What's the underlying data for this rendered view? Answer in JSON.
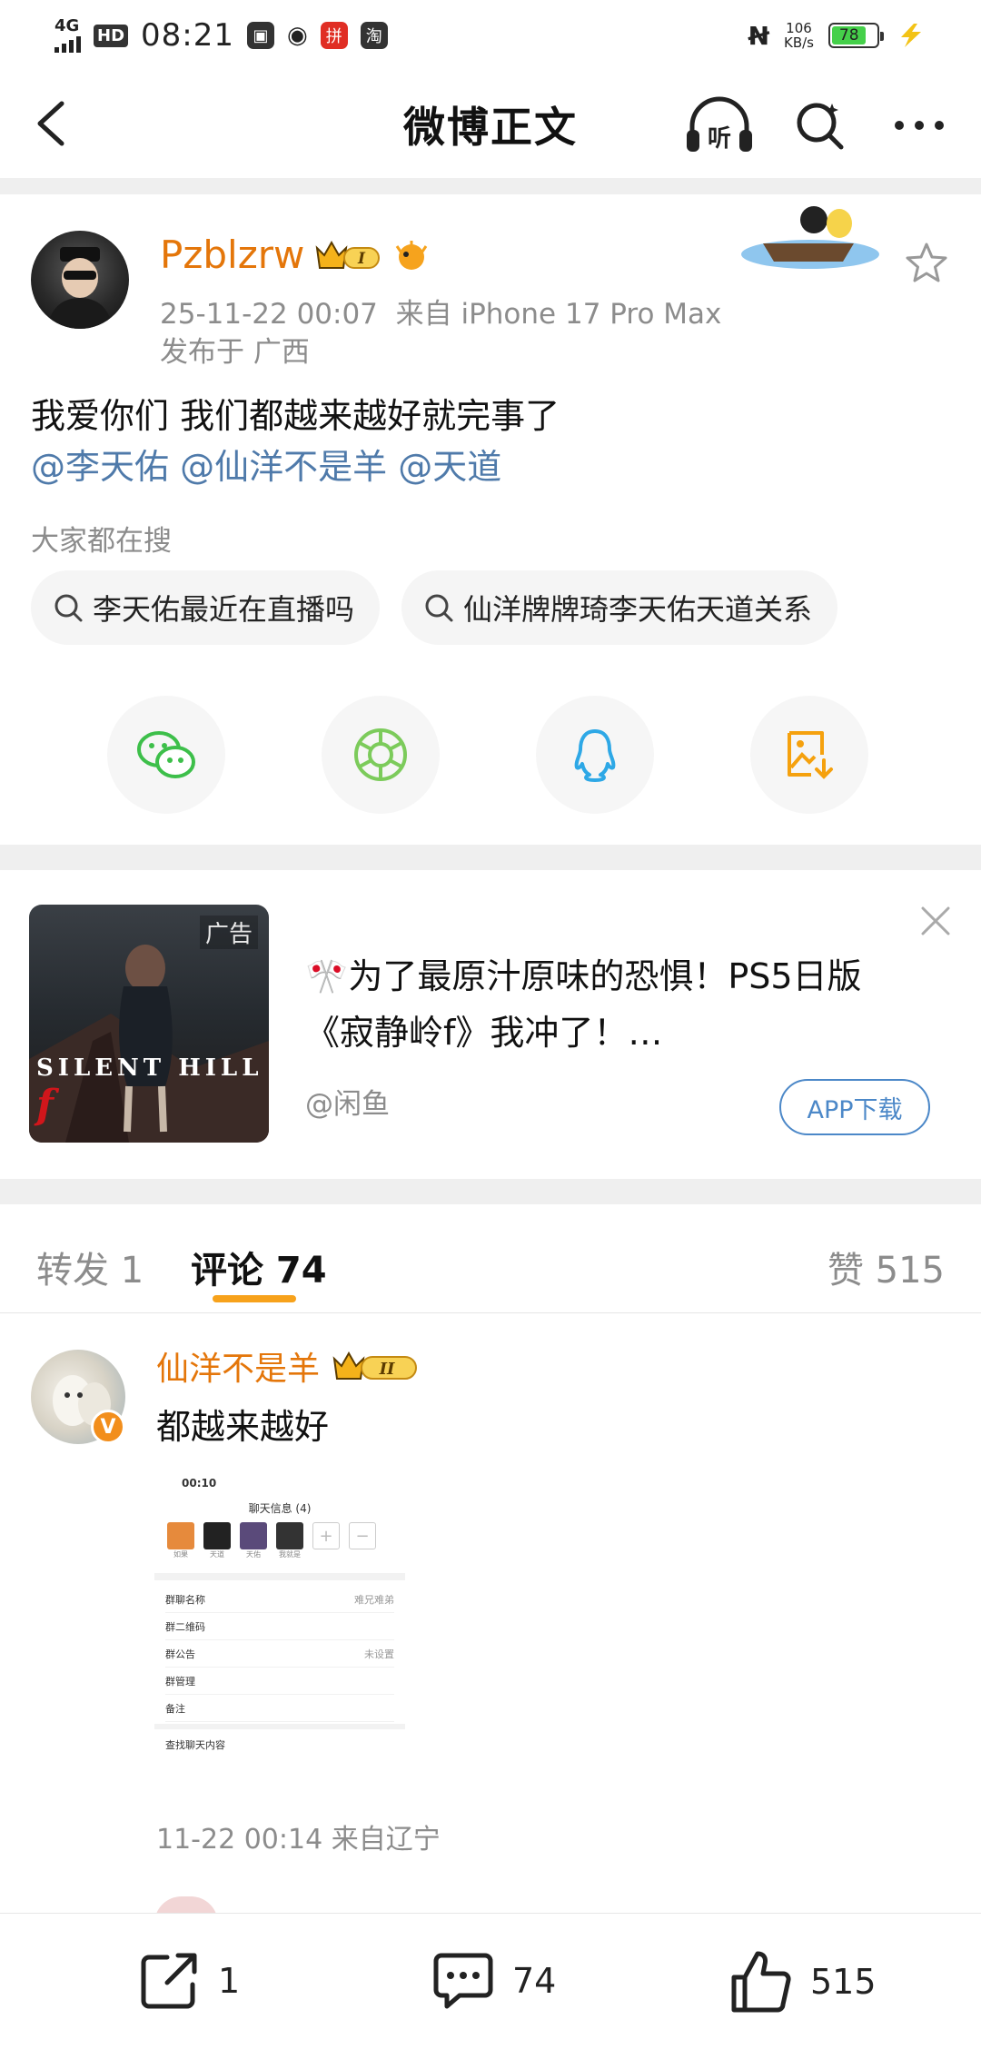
{
  "status_bar": {
    "network": "4G",
    "hd": "HD",
    "time": "08:21",
    "apps": [
      "微博",
      "拼",
      "淘"
    ],
    "speed_value": "106",
    "speed_unit": "KB/s",
    "battery": "78"
  },
  "nav": {
    "title": "微博正文",
    "listen_label": "听"
  },
  "post": {
    "author": "Pzblzrw",
    "vip_level": "I",
    "time": "25-11-22 00:07",
    "source": "来自 iPhone 17 Pro Max",
    "location": "发布于 广西",
    "text_line1": "我爱你们 我们都越来越好就完事了",
    "mentions": [
      "@李天佑",
      "@仙洋不是羊",
      "@天道"
    ],
    "search_title": "大家都在搜",
    "search_chips": [
      "李天佑最近在直播吗",
      "仙洋牌牌琦李天佑天道关系"
    ],
    "share_icons": [
      "wechat-icon",
      "moments-icon",
      "qq-icon",
      "save-image-icon"
    ]
  },
  "ad": {
    "tag": "广告",
    "image_logo": "SILENT HILL",
    "image_logo_f": "f",
    "emoji": "🎌",
    "text_line1": "为了最原汁原味的恐惧！PS5日版",
    "text_line2": "《寂静岭f》我冲了！…",
    "source": "@闲鱼",
    "button": "APP下载"
  },
  "tabs": {
    "repost": "转发 1",
    "comments": "评论 74",
    "likes": "赞 515"
  },
  "comment": {
    "name": "仙洋不是羊",
    "vip_level": "II",
    "verified": "V",
    "text": "都越来越好",
    "screenshot": {
      "time": "00:10",
      "title": "聊天信息 (4)",
      "members": [
        "如果",
        "天道",
        "天佑",
        "我就是"
      ],
      "rows": [
        {
          "label": "群聊名称",
          "value": "难兄难弟"
        },
        {
          "label": "群二维码",
          "value": ""
        },
        {
          "label": "群公告",
          "value": "未设置"
        },
        {
          "label": "群管理",
          "value": ""
        },
        {
          "label": "备注",
          "value": ""
        },
        {
          "label": "查找聊天内容",
          "value": ""
        }
      ]
    },
    "meta": "11-22 00:14 来自辽宁"
  },
  "bottom_bar": {
    "repost_count": "1",
    "comment_count": "74",
    "like_count": "515"
  },
  "colors": {
    "brand_orange": "#e4760a",
    "link_blue": "#4f7aaa",
    "accent_yellow": "#f7a21b"
  }
}
